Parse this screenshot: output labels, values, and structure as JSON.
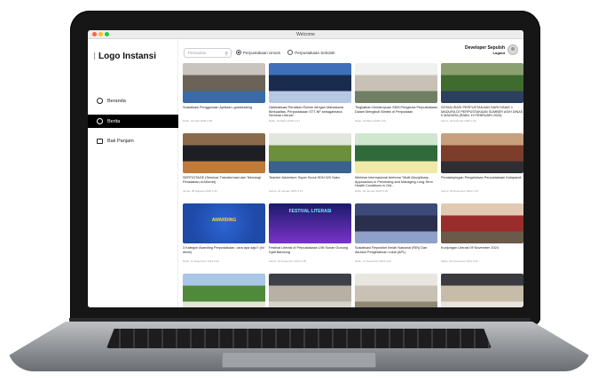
{
  "window": {
    "title": "Welcome"
  },
  "sidebar": {
    "logo": "Logo Instansi",
    "items": [
      {
        "label": "Beranda",
        "active": false
      },
      {
        "label": "Berita",
        "active": true
      },
      {
        "label": "Bak Panjam",
        "active": false
      }
    ]
  },
  "header": {
    "search_placeholder": "Pencarian",
    "radio_options": [
      {
        "label": "Perpustakaan Umum",
        "selected": true
      },
      {
        "label": "Perpustakaan Sekolah",
        "selected": false
      }
    ],
    "user_name": "Developer Sepulsh",
    "logout_label": "Logout"
  },
  "news": [
    {
      "title": "Sosialisasi Penggunaan Aplikasi i-gustokaleng",
      "date": "Rabu, 01 April 2025 3:28",
      "colors": [
        "#6b6258",
        "#c9c4bd",
        "#3b6aa8"
      ]
    },
    {
      "title": "Optimalisasi Peralisan Eirnish dengan Mahasiswa Berkualitas, Perpustakaan STT-NF sebagaimana Seminar Literasi",
      "date": "Rabu, 19 Maret 2025 4:21",
      "colors": [
        "#1a2c4e",
        "#3f6fb8",
        "#b7c8e2"
      ]
    },
    {
      "title": "Tingkatkan Kemampuan SDM Pengelola Perpustakaan Dalam Mengikuti Bimtek di Perpustaan",
      "date": "Rabu, 19 Maret 2025 4:10",
      "colors": [
        "#c8c2b6",
        "#f1f1ef",
        "#6f7f64"
      ]
    },
    {
      "title": "SOSIALISASI PERPUSTAKAAN DARI DINAS 1 MADURA DI PERPUSTAKAAN SUMBER ASIH DINAS II MADURA (RABU 19 FEBRUARI 2025)",
      "date": "Kamis, 20 Februari 2025 1:34",
      "colors": [
        "#3f6b2e",
        "#8b9f71",
        "#2d3f5e"
      ]
    },
    {
      "title": "SERTIGTAGE (Seminar Transformasi dan Teknologi Peradaban di Alhovet)",
      "date": "Jumat, 08 Agustus 2025 2:12",
      "colors": [
        "#1d1f25",
        "#8a6a4a",
        "#c07a3a"
      ]
    },
    {
      "title": "Teacher Adventure Super Scout SDN 020 Sako",
      "date": "Kamis, 04 Januari 2025 4:13",
      "colors": [
        "#6c8f3c",
        "#e3e6dd",
        "#39628e"
      ]
    },
    {
      "title": "Webinar Internasional bertema \"Multi-Disciplinary Approaches in Preventing and Managing Long-Term Health Conditions in Old...",
      "date": "Rabu, 04 Januari 2025 3:30",
      "colors": [
        "#2f6b3a",
        "#cfe6cf",
        "#f0e9a8"
      ]
    },
    {
      "title": "Pendampingan Pengelolaan Perpustakaan Kotopandi",
      "date": "Kamis, 28 Desember 2024 1:10",
      "colors": [
        "#7c3d2a",
        "#c9a07c",
        "#2f2f33"
      ]
    },
    {
      "title": "3 Kategori Awarding Perpustakaan, cara apa sajo? (ini disini)",
      "date": "Rabu, 11 Desember 2024 3:26",
      "colors": [
        "#1f4aa8",
        "#2c66d6",
        "#1a2f6e"
      ]
    },
    {
      "title": "Festival Literasi di Perpustakaan UIN Sunan Gunung Djati Bandung",
      "date": "Kamis, 12 Desember 2024 2:45",
      "colors": [
        "#1a1a6b",
        "#3c2f9a",
        "#7a33c9"
      ]
    },
    {
      "title": "Sosialisasi Repositori Ilmiah Nasional (RIN) Dan Akuisisi Pengetahuan Lokal (APL)",
      "date": "Rabu, 11 Desember 2024 2:22",
      "colors": [
        "#2a2f4e",
        "#3c4a7a",
        "#8fa0c9"
      ]
    },
    {
      "title": "Kunjungan Literasi 09 November 2024",
      "date": "Sabtu, 09 November 2024 3:12",
      "colors": [
        "#9b2c2c",
        "#e2c9b4",
        "#6a5a4a"
      ]
    },
    {
      "title": "",
      "date": "",
      "colors": [
        "#4f8a3a",
        "#a9c6e6",
        "#e5e3d8"
      ]
    },
    {
      "title": "",
      "date": "",
      "colors": [
        "#b8b0a4",
        "#3d4048",
        "#d6d3cd"
      ]
    },
    {
      "title": "",
      "date": "",
      "colors": [
        "#c9c2b4",
        "#e9e6e0",
        "#8f8676"
      ]
    },
    {
      "title": "",
      "date": "",
      "colors": [
        "#c7bca8",
        "#3a3a40",
        "#e8e4dd"
      ]
    }
  ],
  "thumb_text": {
    "awarding": "AWARDING",
    "festival": "FESTIVAL LITERASI"
  }
}
